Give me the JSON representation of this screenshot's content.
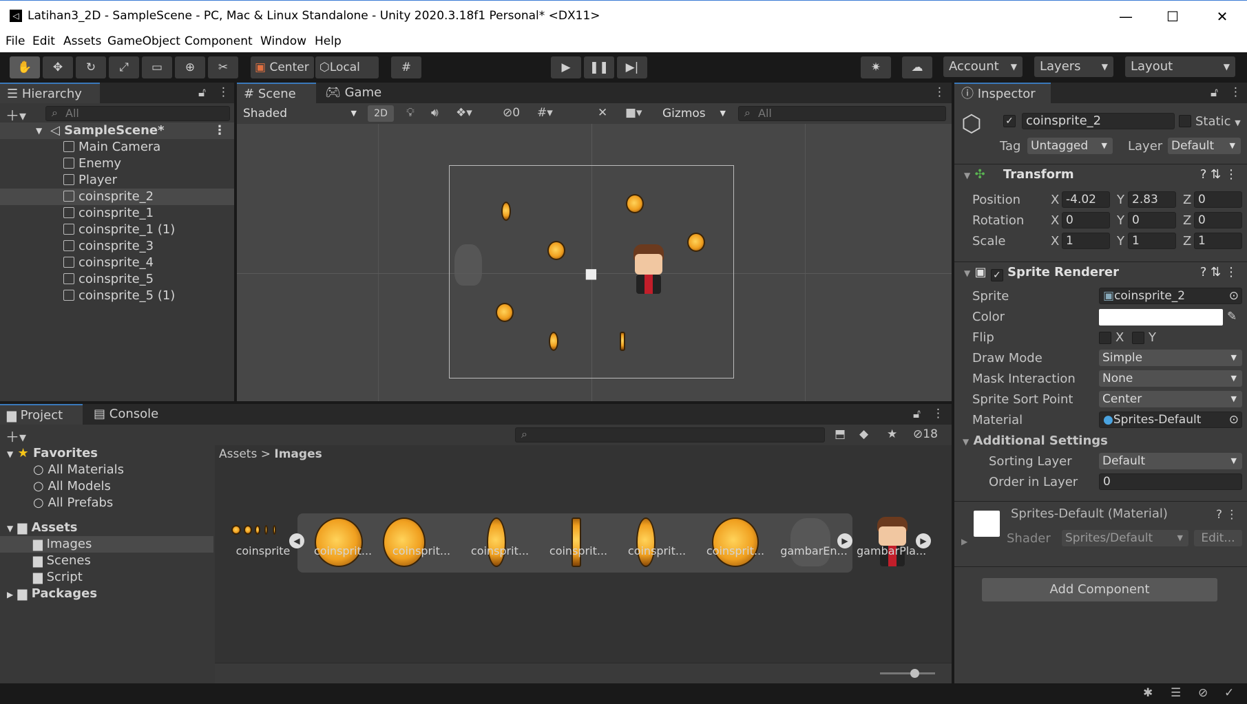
{
  "window": {
    "title": "Latihan3_2D - SampleScene - PC, Mac & Linux Standalone - Unity 2020.3.18f1 Personal* <DX11>",
    "minimize": "—",
    "maximize": "☐",
    "close": "✕"
  },
  "menu": [
    "File",
    "Edit",
    "Assets",
    "GameObject",
    "Component",
    "Window",
    "Help"
  ],
  "toolbar": {
    "pivot": "Center",
    "space": "Local",
    "account": "Account",
    "layers": "Layers",
    "layout": "Layout"
  },
  "hierarchy": {
    "tab": "Hierarchy",
    "search_placeholder": "All",
    "scene": "SampleScene*",
    "items": [
      "Main Camera",
      "Enemy",
      "Player",
      "coinsprite_2",
      "coinsprite_1",
      "coinsprite_1 (1)",
      "coinsprite_3",
      "coinsprite_4",
      "coinsprite_5",
      "coinsprite_5 (1)"
    ],
    "selected": "coinsprite_2"
  },
  "scene_view": {
    "tab_scene": "Scene",
    "tab_game": "Game",
    "shading": "Shaded",
    "mode2d": "2D",
    "hidden_count": "0",
    "gizmos": "Gizmos",
    "search_placeholder": "All"
  },
  "project": {
    "tab_project": "Project",
    "tab_console": "Console",
    "hidden_count": "18",
    "favorites": "Favorites",
    "fav_items": [
      "All Materials",
      "All Models",
      "All Prefabs"
    ],
    "assets": "Assets",
    "asset_folders": [
      "Images",
      "Scenes",
      "Script"
    ],
    "packages": "Packages",
    "breadcrumb_root": "Assets",
    "breadcrumb_sep": ">",
    "breadcrumb_current": "Images",
    "thumbs": [
      "coinsprite",
      "coinsprit...",
      "coinsprit...",
      "coinsprit...",
      "coinsprit...",
      "coinsprit...",
      "coinsprit...",
      "gambarEn...",
      "gambarPla..."
    ]
  },
  "inspector": {
    "tab": "Inspector",
    "object_name": "coinsprite_2",
    "static": "Static",
    "tag_label": "Tag",
    "tag": "Untagged",
    "layer_label": "Layer",
    "layer": "Default",
    "transform": {
      "title": "Transform",
      "position_label": "Position",
      "rotation_label": "Rotation",
      "scale_label": "Scale",
      "position": [
        "-4.02",
        "2.83",
        "0"
      ],
      "rotation": [
        "0",
        "0",
        "0"
      ],
      "scale": [
        "1",
        "1",
        "1"
      ],
      "axes": [
        "X",
        "Y",
        "Z"
      ]
    },
    "sprite_renderer": {
      "title": "Sprite Renderer",
      "sprite_label": "Sprite",
      "sprite": "coinsprite_2",
      "color_label": "Color",
      "flip_label": "Flip",
      "flip_x": "X",
      "flip_y": "Y",
      "draw_mode_label": "Draw Mode",
      "draw_mode": "Simple",
      "mask_label": "Mask Interaction",
      "mask": "None",
      "sort_point_label": "Sprite Sort Point",
      "sort_point": "Center",
      "material_label": "Material",
      "material": "Sprites-Default",
      "additional": "Additional Settings",
      "sorting_layer_label": "Sorting Layer",
      "sorting_layer": "Default",
      "order_label": "Order in Layer",
      "order": "0"
    },
    "material": {
      "title": "Sprites-Default (Material)",
      "shader_label": "Shader",
      "shader": "Sprites/Default",
      "edit": "Edit..."
    },
    "add_component": "Add Component"
  }
}
